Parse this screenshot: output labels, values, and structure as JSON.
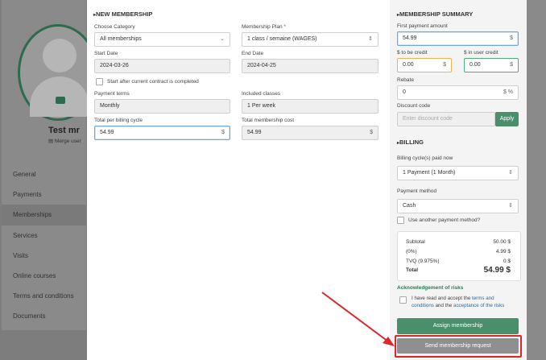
{
  "background": {
    "user_name": "Test mr",
    "merge_label": "Merge user",
    "nav": [
      {
        "label": "General"
      },
      {
        "label": "Payments"
      },
      {
        "label": "Memberships"
      },
      {
        "label": "Services"
      },
      {
        "label": "Visits"
      },
      {
        "label": "Online courses"
      },
      {
        "label": "Terms and conditions"
      },
      {
        "label": "Documents"
      }
    ]
  },
  "new_membership": {
    "title": "NEW MEMBERSHIP",
    "choose_category_label": "Choose Category",
    "choose_category_value": "All memberships",
    "membership_plan_label": "Membership Plan",
    "membership_plan_required": "*",
    "membership_plan_value": "1 class / semaine (WAGES)",
    "start_date_label": "Start Date",
    "start_date_value": "2024-03-26",
    "end_date_label": "End Date",
    "end_date_value": "2024-04-25",
    "start_after_label": "Start after current contract is completed",
    "payment_terms_label": "Payment terms",
    "payment_terms_value": "Monthly",
    "included_classes_label": "Included classes",
    "included_classes_value": "1 Per week",
    "total_per_cycle_label": "Total per billing cycle",
    "total_per_cycle_value": "54.99",
    "total_cost_label": "Total membership cost",
    "total_cost_value": "54.99",
    "currency": "$"
  },
  "summary": {
    "title": "MEMBERSHIP SUMMARY",
    "first_payment_label": "First payment amount",
    "first_payment_value": "54.99",
    "to_be_credit_label": "$ to be credit",
    "to_be_credit_value": "0.00",
    "in_user_credit_label": "$ in user credit",
    "in_user_credit_value": "0.00",
    "rebate_label": "Rebate",
    "rebate_value": "0",
    "rebate_suffix": "$ %",
    "discount_label": "Discount code",
    "discount_placeholder": "Enter discount code",
    "apply_label": "Apply",
    "currency": "$"
  },
  "billing": {
    "title": "BILLING",
    "cycles_label": "Billing cycle(s) paid now",
    "cycles_value": "1 Payment (1 Month)",
    "method_label": "Payment method",
    "method_value": "Cash",
    "another_method_label": "Use another payment method?",
    "totals": {
      "subtotal_label": "Subtotal",
      "subtotal_value": "50.00 $",
      "tax1_label": "(0%)",
      "tax1_value": "4.99 $",
      "tax2_label": "TVQ (9.975%)",
      "tax2_value": "0 $",
      "total_label": "Total",
      "total_value": "54.99 $"
    },
    "ack_title": "Acknowledgement of risks",
    "ack_text_1": "I have read and accept the",
    "ack_link_1": "terms and conditions",
    "ack_text_2": "and the",
    "ack_link_2": "acceptance of the risks",
    "assign_label": "Assign membership",
    "send_request_label": "Send membership request"
  },
  "colors": {
    "accent_green": "#4a8f6c",
    "disabled_gray": "#8f8f8f",
    "highlight_red": "#e0242b"
  }
}
